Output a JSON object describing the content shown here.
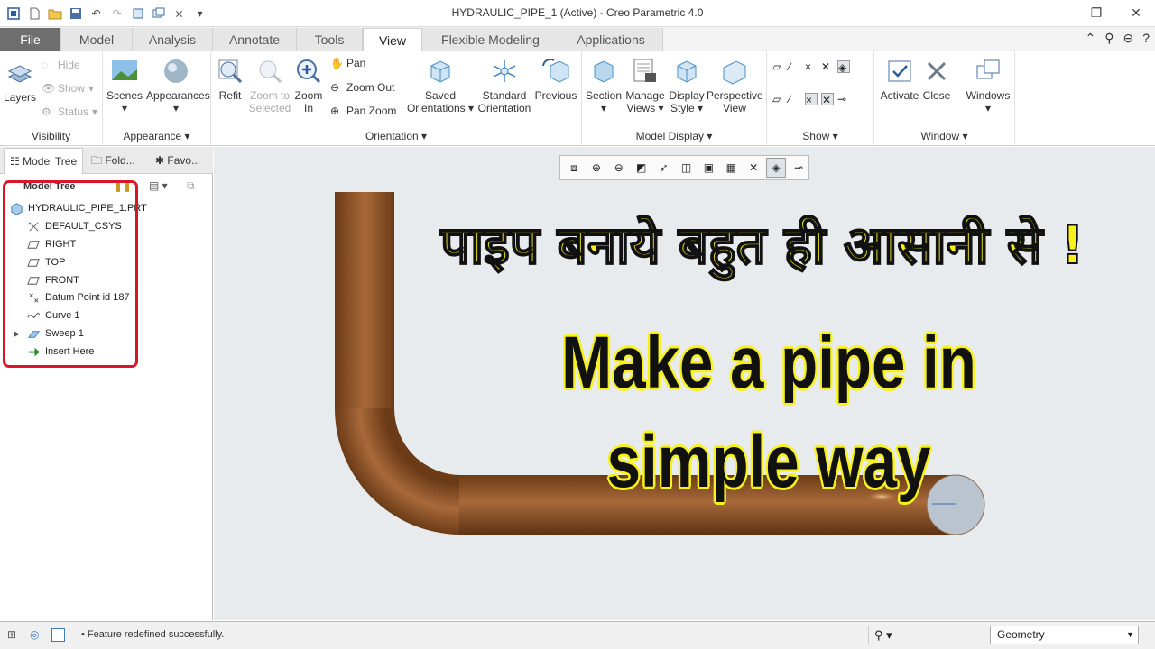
{
  "window": {
    "title": "HYDRAULIC_PIPE_1 (Active) - Creo Parametric 4.0"
  },
  "tabs": [
    "File",
    "Model",
    "Analysis",
    "Annotate",
    "Tools",
    "View",
    "Flexible Modeling",
    "Applications"
  ],
  "ribbon": {
    "visibility": {
      "layers": "Layers",
      "hide": "Hide",
      "show": "Show",
      "status": "Status",
      "label": "Visibility"
    },
    "appearance": {
      "scenes": "Scenes",
      "appearances": "Appearances",
      "label": "Appearance"
    },
    "orientation": {
      "refit": "Refit",
      "zoom_selected_1": "Zoom to",
      "zoom_selected_2": "Selected",
      "zoom_in_1": "Zoom",
      "zoom_in_2": "In",
      "pan": "Pan",
      "zoom_out": "Zoom Out",
      "pan_zoom": "Pan Zoom",
      "saved_1": "Saved",
      "saved_2": "Orientations",
      "standard_1": "Standard",
      "standard_2": "Orientation",
      "previous": "Previous",
      "label": "Orientation"
    },
    "model_display": {
      "section": "Section",
      "manage_1": "Manage",
      "manage_2": "Views",
      "display_1": "Display",
      "display_2": "Style",
      "perspective_1": "Perspective",
      "perspective_2": "View",
      "label": "Model Display"
    },
    "show": {
      "label": "Show"
    },
    "window": {
      "activate": "Activate",
      "close": "Close",
      "windows": "Windows",
      "label": "Window"
    }
  },
  "panel": {
    "tabs": [
      "Model Tree",
      "Fold...",
      "Favo..."
    ],
    "header": "Model Tree",
    "items": [
      "HYDRAULIC_PIPE_1.PRT",
      "DEFAULT_CSYS",
      "RIGHT",
      "TOP",
      "FRONT",
      "Datum Point id 187",
      "Curve 1",
      "Sweep 1",
      "Insert Here"
    ]
  },
  "overlay": {
    "hindi": "पाइप बनाये बहुत ही आसानी से !",
    "english": "Make a pipe in simple way"
  },
  "status": {
    "message": "Feature redefined successfully.",
    "filter": "Geometry"
  },
  "colors": {
    "pipe": "#8c5327",
    "highlight": "#d9152a",
    "overlay_text": "#f7f21d"
  }
}
